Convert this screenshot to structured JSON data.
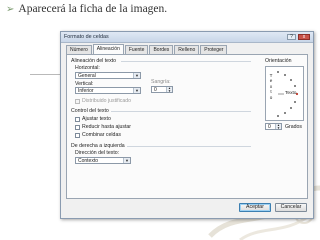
{
  "slide": {
    "bullet_icon": "arrow-bullet-icon",
    "bullet_text": "Aparecerá la ficha de la imagen."
  },
  "dialog": {
    "title": "Formato de celdas",
    "help_label": "?",
    "close_label": "x",
    "tabs": [
      {
        "label": "Número"
      },
      {
        "label": "Alineación"
      },
      {
        "label": "Fuente"
      },
      {
        "label": "Bordes"
      },
      {
        "label": "Relleno"
      },
      {
        "label": "Proteger"
      }
    ],
    "active_tab": "Alineación",
    "text_alignment": {
      "heading": "Alineación del texto",
      "horizontal_label": "Horizontal:",
      "horizontal_value": "General",
      "indent_label": "Sangría:",
      "indent_value": "0",
      "vertical_label": "Vertical:",
      "vertical_value": "Inferior",
      "distributed_label": "Distribuido justificado"
    },
    "text_control": {
      "heading": "Control del texto",
      "wrap_label": "Ajustar texto",
      "shrink_label": "Reducir hasta ajustar",
      "merge_label": "Combinar celdas"
    },
    "rtl": {
      "heading": "De derecha a izquierda",
      "direction_label": "Dirección del texto:",
      "direction_value": "Contexto"
    },
    "orientation": {
      "heading": "Orientación",
      "vertical_text": [
        "T",
        "e",
        "x",
        "t",
        "o"
      ],
      "needle_text": "Texto",
      "degrees_value": "0",
      "degrees_label": "Grados"
    },
    "buttons": {
      "ok": "Aceptar",
      "cancel": "Cancelar"
    }
  }
}
